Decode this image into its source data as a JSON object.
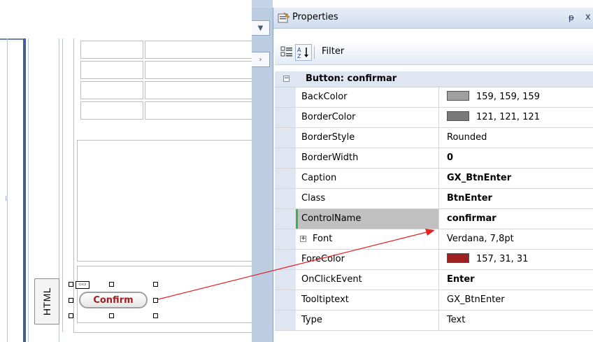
{
  "designer": {
    "html_tab_label": "HTML",
    "confirm_button_label": "Confirm",
    "confirm_button_color": "#9d1f1f"
  },
  "properties": {
    "title": "Properties",
    "toolbar": {
      "filter_label": "Filter",
      "categorized_icon": "categorized-icon",
      "sort_icon": "sort-az-icon"
    },
    "category_label": "Button: confirmar",
    "rows": [
      {
        "name": "BackColor",
        "value": "159, 159, 159",
        "swatch": "#9f9f9f"
      },
      {
        "name": "BorderColor",
        "value": "121, 121, 121",
        "swatch": "#797979"
      },
      {
        "name": "BorderStyle",
        "value": "Rounded"
      },
      {
        "name": "BorderWidth",
        "value": "0"
      },
      {
        "name": "Caption",
        "value": "GX_BtnEnter"
      },
      {
        "name": "Class",
        "value": "BtnEnter"
      },
      {
        "name": "ControlName",
        "value": "confirmar"
      },
      {
        "name": "Font",
        "value": "Verdana, 7,8pt"
      },
      {
        "name": "ForeColor",
        "value": "157, 31, 31",
        "swatch": "#9d1f1f"
      },
      {
        "name": "OnClickEvent",
        "value": "Enter"
      },
      {
        "name": "Tooltiptext",
        "value": "GX_BtnEnter"
      },
      {
        "name": "Type",
        "value": "Text"
      }
    ],
    "pin_glyph": "ᵽ",
    "close_glyph": "x",
    "expander_plus": "+",
    "collapse_minus": "−"
  },
  "colors": {
    "annotation_arrow": "#e32424",
    "selected_marker": "#3fae4c"
  }
}
